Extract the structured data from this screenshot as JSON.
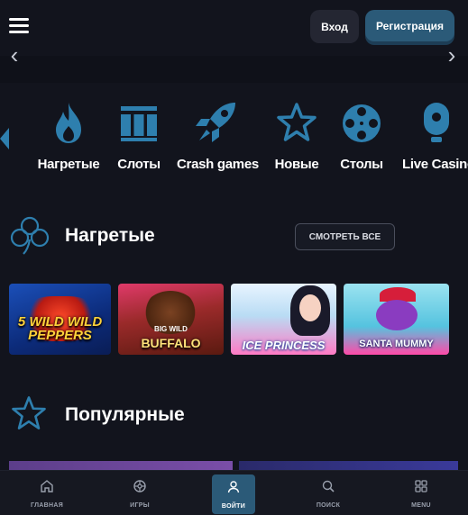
{
  "header": {
    "login_label": "Вход",
    "register_label": "Регистрация"
  },
  "categories": [
    {
      "label": "Нагретые",
      "icon": "fire-icon"
    },
    {
      "label": "Слоты",
      "icon": "slots-icon"
    },
    {
      "label": "Crash games",
      "icon": "rocket-icon"
    },
    {
      "label": "Новые",
      "icon": "star-icon"
    },
    {
      "label": "Столы",
      "icon": "film-reel-icon"
    },
    {
      "label": "Live Casino",
      "icon": "webcam-icon"
    }
  ],
  "hot_section": {
    "title": "Нагретые",
    "see_all_label": "СМОТРЕТЬ ВСЕ",
    "games": [
      {
        "title": "5 WILD WILD PEPPERS"
      },
      {
        "title_small": "BIG WILD",
        "title": "BUFFALO"
      },
      {
        "title": "ICE PRINCESS"
      },
      {
        "title": "SANTA MUMMY"
      }
    ]
  },
  "popular_section": {
    "title": "Популярные"
  },
  "bottom_nav": [
    {
      "label": "ГЛАВНАЯ",
      "icon": "home-icon"
    },
    {
      "label": "ИГРЫ",
      "icon": "games-icon"
    },
    {
      "label": "ВОЙТИ",
      "icon": "user-icon"
    },
    {
      "label": "ПОИСК",
      "icon": "search-icon"
    },
    {
      "label": "MENU",
      "icon": "grid-icon"
    }
  ],
  "colors": {
    "background": "#12141d",
    "accent": "#2b5a78",
    "icon_blue": "#2e7fae"
  }
}
